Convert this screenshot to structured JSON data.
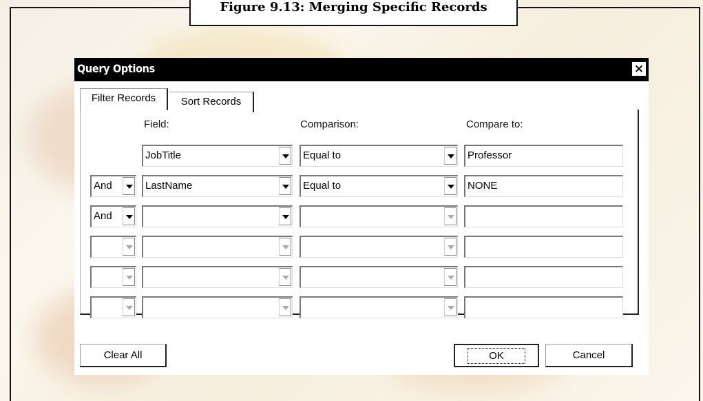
{
  "figure_caption": "Figure 9.13: Merging Specific Records",
  "dialog": {
    "title": "Query Options",
    "close_symbol": "×",
    "tabs": [
      {
        "label": "Filter Records",
        "active": true
      },
      {
        "label": "Sort Records",
        "active": false
      }
    ],
    "headers": {
      "field": "Field:",
      "comparison": "Comparison:",
      "compare_to": "Compare to:"
    },
    "rows": [
      {
        "connector": "",
        "field": "JobTitle",
        "comparison": "Equal to",
        "compare_to": "Professor"
      },
      {
        "connector": "And",
        "field": "LastName",
        "comparison": "Equal to",
        "compare_to": "NONE"
      },
      {
        "connector": "And",
        "field": "",
        "comparison": "",
        "compare_to": ""
      },
      {
        "connector": "",
        "field": "",
        "comparison": "",
        "compare_to": ""
      },
      {
        "connector": "",
        "field": "",
        "comparison": "",
        "compare_to": ""
      },
      {
        "connector": "",
        "field": "",
        "comparison": "",
        "compare_to": ""
      }
    ],
    "buttons": {
      "clear_all": "Clear All",
      "ok": "OK",
      "cancel": "Cancel"
    }
  }
}
